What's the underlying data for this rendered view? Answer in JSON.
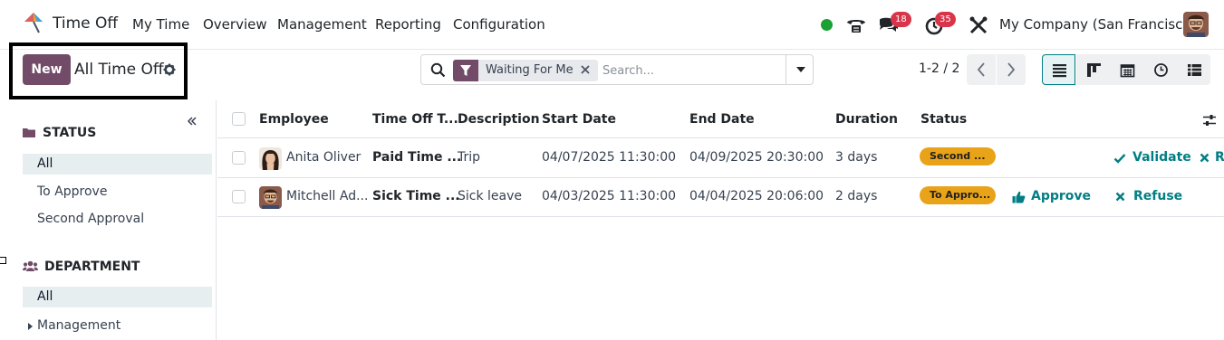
{
  "navbar": {
    "app_name": "Time Off",
    "menu": [
      "My Time",
      "Overview",
      "Management",
      "Reporting",
      "Configuration"
    ],
    "messages_count": "18",
    "activities_count": "35",
    "company": "My Company (San Francisco)"
  },
  "control_panel": {
    "new_label": "New",
    "title": "All Time Off",
    "search": {
      "facet_label": "Waiting For Me",
      "placeholder": "Search..."
    },
    "pager": "1-2 / 2"
  },
  "sidebar": {
    "status_heading": "STATUS",
    "status_items": [
      "All",
      "To Approve",
      "Second Approval"
    ],
    "department_heading": "DEPARTMENT",
    "department_items": [
      "All",
      "Management"
    ]
  },
  "table": {
    "columns": [
      "Employee",
      "Time Off T...",
      "Description",
      "Start Date",
      "End Date",
      "Duration",
      "Status"
    ],
    "rows": [
      {
        "employee": "Anita Oliver",
        "time_off_type": "Paid Time ...",
        "description": "Trip",
        "start_date": "04/07/2025 11:30:00",
        "end_date": "04/09/2025 20:30:00",
        "duration": "3 days",
        "status": "Second ...",
        "actions": [
          "Validate",
          "R"
        ]
      },
      {
        "employee": "Mitchell Ad...",
        "time_off_type": "Sick Time ...",
        "description": "Sick leave",
        "start_date": "04/03/2025 11:30:00",
        "end_date": "04/04/2025 20:06:00",
        "duration": "2 days",
        "status": "To Appro...",
        "actions": [
          "Approve",
          "Refuse"
        ]
      }
    ]
  },
  "colors": {
    "brand": "#714b67",
    "action": "#017e84",
    "status_pill": "#e9a319",
    "badge": "#d9354a",
    "online_dot": "#1aa033"
  },
  "icons": [
    "app-logo-icon",
    "phone-icon",
    "chat-icon",
    "clock-icon",
    "tools-icon",
    "gear-icon",
    "search-icon",
    "filter-icon",
    "close-icon",
    "caret-down-icon",
    "chevron-left-icon",
    "chevron-right-icon",
    "list-view-icon",
    "kanban-view-icon",
    "calendar-view-icon",
    "activity-view-icon",
    "pivot-view-icon",
    "double-chevron-left-icon",
    "folder-icon",
    "users-icon",
    "check-icon",
    "thumbs-up-icon",
    "x-icon",
    "column-settings-icon"
  ]
}
